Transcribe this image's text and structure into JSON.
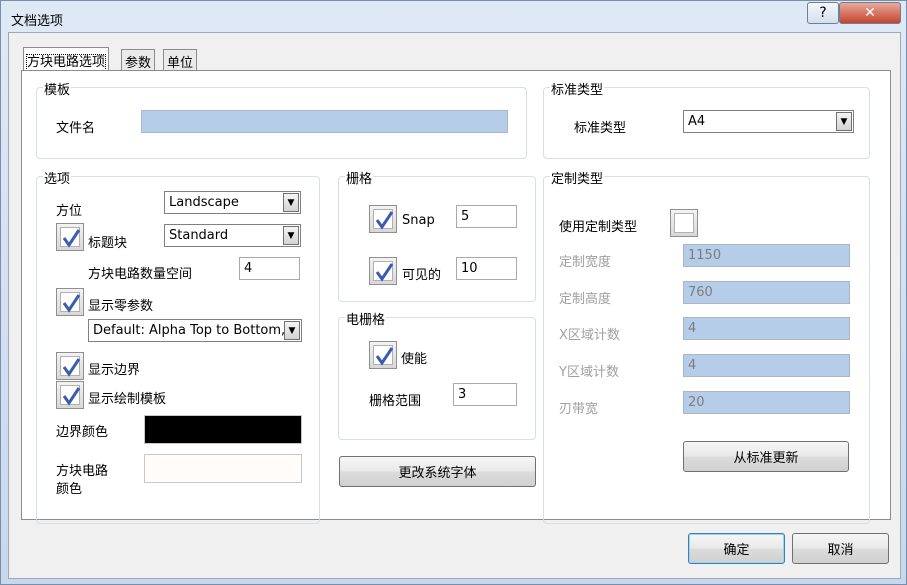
{
  "window": {
    "title": "文档选项",
    "help_label": "?",
    "close_label": "✕"
  },
  "tabs": [
    "方块电路选项",
    "参数",
    "单位"
  ],
  "template": {
    "group_title": "模板",
    "filename_label": "文件名",
    "filename_value": ""
  },
  "standard_type": {
    "group_title": "标准类型",
    "label": "标准类型",
    "value": "A4"
  },
  "options": {
    "group_title": "选项",
    "orientation_label": "方位",
    "orientation_value": "Landscape",
    "title_block_label": "标题块",
    "title_block_checked": true,
    "title_block_value": "Standard",
    "sheet_number_spaces_label": "方块电路数量空间",
    "sheet_number_spaces_value": "4",
    "show_zero_params_label": "显示零参数",
    "show_zero_params_checked": true,
    "default_mode_value": "Default: Alpha Top to Bottom,",
    "show_border_label": "显示边界",
    "show_border_checked": true,
    "show_template_graphics_label": "显示绘制模板",
    "show_template_graphics_checked": true,
    "border_color_label": "边界颜色",
    "border_color": "#000000",
    "sheet_color_label_1": "方块电路",
    "sheet_color_label_2": "颜色",
    "sheet_color": "#fffcfa"
  },
  "grids": {
    "group_title": "栅格",
    "snap_label": "Snap",
    "snap_checked": true,
    "snap_value": "5",
    "visible_label": "可见的",
    "visible_checked": true,
    "visible_value": "10"
  },
  "electrical_grid": {
    "group_title": "电栅格",
    "enable_label": "使能",
    "enable_checked": true,
    "range_label": "栅格范围",
    "range_value": "3"
  },
  "change_font_button": "更改系统字体",
  "custom_type": {
    "group_title": "定制类型",
    "use_custom_label": "使用定制类型",
    "use_custom_checked": false,
    "width_label": "定制宽度",
    "width_value": "1150",
    "height_label": "定制高度",
    "height_value": "760",
    "x_regions_label": "X区域计数",
    "x_regions_value": "4",
    "y_regions_label": "Y区域计数",
    "y_regions_value": "4",
    "margin_label": "刃带宽",
    "margin_value": "20",
    "update_button": "从标准更新"
  },
  "footer": {
    "ok_button": "确定",
    "cancel_button": "取消"
  },
  "colors": {
    "accent": "#3c7fb1",
    "field_blue": "#b6cde9",
    "check_blue": "#3b5cae"
  }
}
